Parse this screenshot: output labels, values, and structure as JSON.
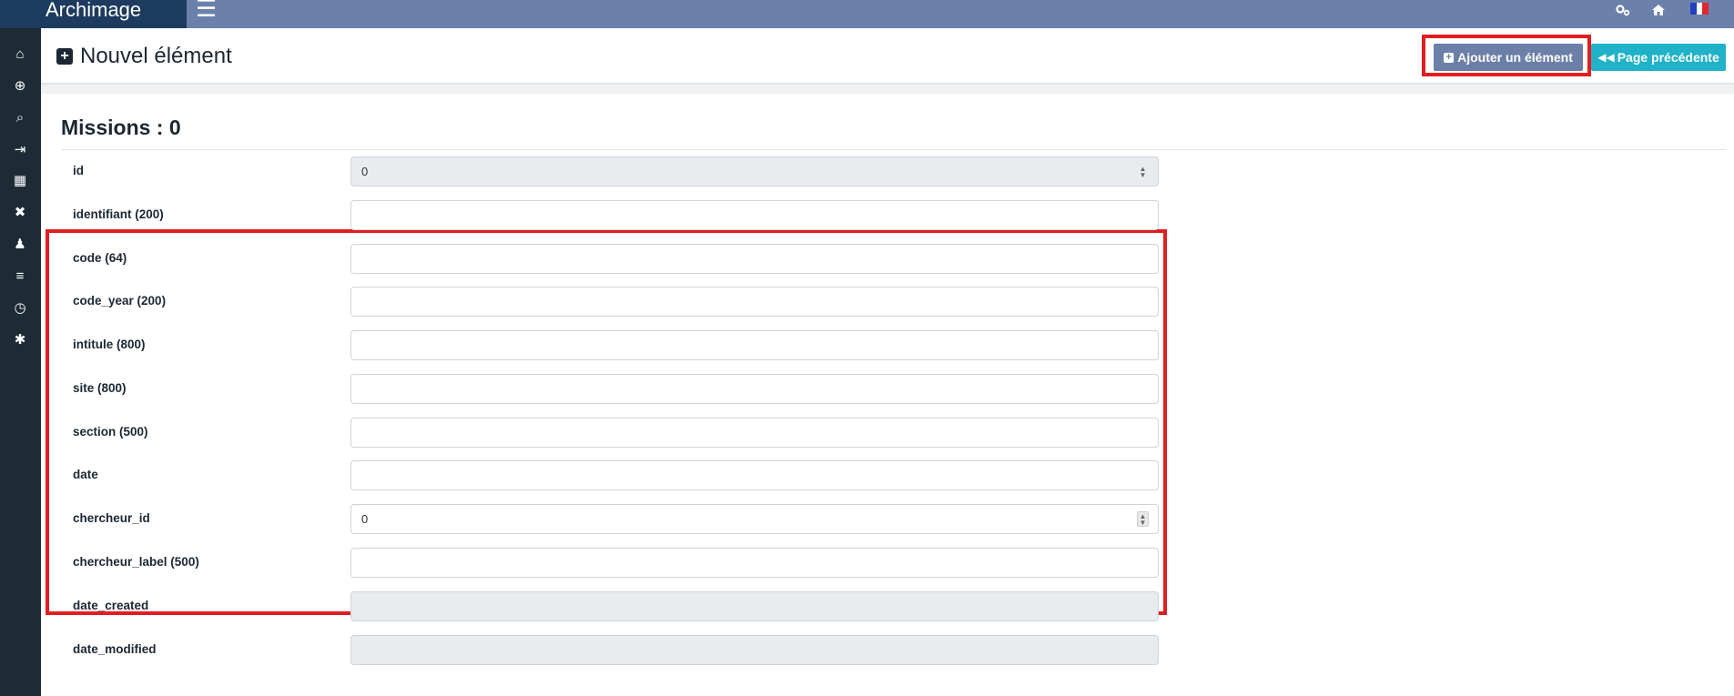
{
  "app": {
    "brand": "Archimage",
    "top_icons": [
      "settings-icon",
      "home-icon",
      "flag-fr-icon"
    ],
    "flag_colors": [
      "#1f3fbd",
      "#ffffff",
      "#e0272a"
    ]
  },
  "sidebar": {
    "items": [
      {
        "icon": "home-icon",
        "glyph": "⌂"
      },
      {
        "icon": "add-circle-icon",
        "glyph": "⊕"
      },
      {
        "icon": "search-icon",
        "glyph": "⌕"
      },
      {
        "icon": "import-icon",
        "glyph": "⇥"
      },
      {
        "icon": "table-icon",
        "glyph": "▦"
      },
      {
        "icon": "tools-icon",
        "glyph": "✖"
      },
      {
        "icon": "user-edit-icon",
        "glyph": "♟"
      },
      {
        "icon": "database-icon",
        "glyph": "≡"
      },
      {
        "icon": "history-icon",
        "glyph": "◷"
      },
      {
        "icon": "bug-icon",
        "glyph": "✱"
      }
    ]
  },
  "header": {
    "title": "Nouvel élément",
    "add_button": "Ajouter un élément",
    "prev_button": "Page précédente"
  },
  "colors": {
    "topbar": "#6b81ac",
    "brand_bg": "#1d3b5e",
    "sidebar_bg": "#1d2b35",
    "add_button": "#6b7fa8",
    "prev_button": "#1fb2c9",
    "highlight": "#e01e21",
    "readonly_field": "#e9ecef"
  },
  "form": {
    "section_title": "Missions : 0",
    "fields": [
      {
        "label": "id",
        "value": "0",
        "readonly": true,
        "spinner": true
      },
      {
        "label": "identifiant (200)",
        "value": "",
        "readonly": false,
        "spinner": false
      },
      {
        "label": "code (64)",
        "value": "",
        "readonly": false,
        "spinner": false
      },
      {
        "label": "code_year (200)",
        "value": "",
        "readonly": false,
        "spinner": false
      },
      {
        "label": "intitule (800)",
        "value": "",
        "readonly": false,
        "spinner": false
      },
      {
        "label": "site (800)",
        "value": "",
        "readonly": false,
        "spinner": false
      },
      {
        "label": "section (500)",
        "value": "",
        "readonly": false,
        "spinner": false
      },
      {
        "label": "date",
        "value": "",
        "readonly": false,
        "spinner": false
      },
      {
        "label": "chercheur_id",
        "value": "0",
        "readonly": false,
        "spinner": true
      },
      {
        "label": "chercheur_label (500)",
        "value": "",
        "readonly": false,
        "spinner": false
      },
      {
        "label": "date_created",
        "value": "",
        "readonly": true,
        "spinner": false
      },
      {
        "label": "date_modified",
        "value": "",
        "readonly": true,
        "spinner": false
      }
    ]
  }
}
